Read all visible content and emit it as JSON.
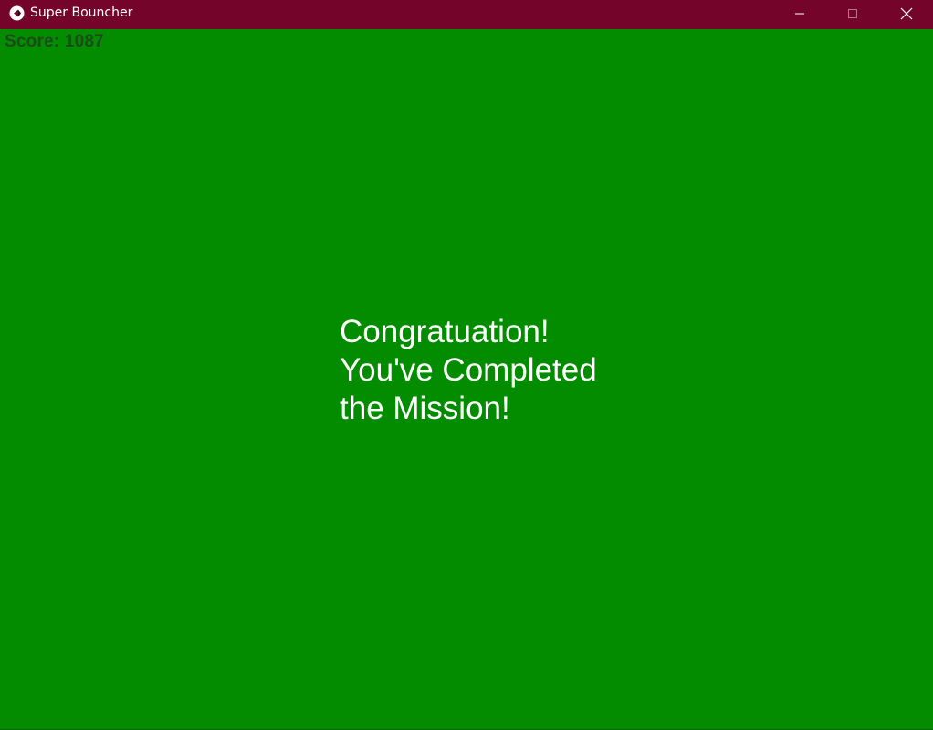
{
  "window": {
    "title": "Super Bouncher",
    "icons": {
      "app": "unity-logo-icon",
      "minimize": "minimize-icon",
      "maximize": "maximize-icon",
      "close": "close-icon"
    },
    "colors": {
      "titlebar": "#740429",
      "background": "#048c00",
      "score_text": "#1d4a1d",
      "message_text": "#ffffff"
    }
  },
  "hud": {
    "score_text": "Score: 1087"
  },
  "message": {
    "line1": "Congratuation!",
    "line2": "You've Completed",
    "line3": "the Mission!"
  }
}
